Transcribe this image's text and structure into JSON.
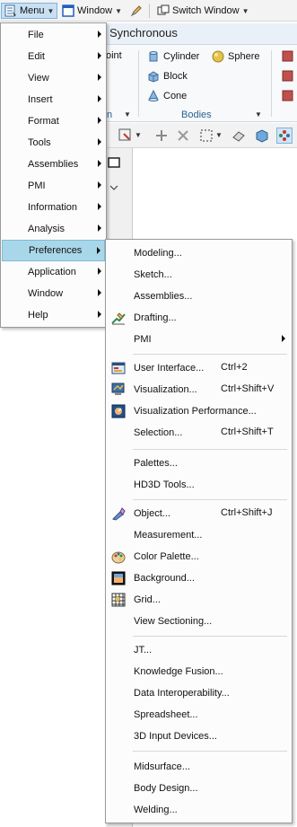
{
  "topbar": {
    "menu_label": "Menu",
    "window_label": "Window",
    "switch_window_label": "Switch Window"
  },
  "ribbon": {
    "tab_label": "Synchronous",
    "point_label": "oint",
    "group_label_left": "n",
    "cylinder_label": "Cylinder",
    "sphere_label": "Sphere",
    "block_label": "Block",
    "cone_label": "Cone",
    "bodies_group_label": "Bodies"
  },
  "main_menu": {
    "items": [
      {
        "label": "File"
      },
      {
        "label": "Edit"
      },
      {
        "label": "View"
      },
      {
        "label": "Insert"
      },
      {
        "label": "Format"
      },
      {
        "label": "Tools"
      },
      {
        "label": "Assemblies"
      },
      {
        "label": "PMI"
      },
      {
        "label": "Information"
      },
      {
        "label": "Analysis"
      },
      {
        "label": "Preferences"
      },
      {
        "label": "Application"
      },
      {
        "label": "Window"
      },
      {
        "label": "Help"
      }
    ],
    "highlighted": "Preferences"
  },
  "preferences_menu": {
    "items": [
      {
        "label": "Modeling...",
        "shortcut": "",
        "icon": ""
      },
      {
        "label": "Sketch...",
        "shortcut": "",
        "icon": ""
      },
      {
        "label": "Assemblies...",
        "shortcut": "",
        "icon": ""
      },
      {
        "label": "Drafting...",
        "shortcut": "",
        "icon": "drafting-icon"
      },
      {
        "label": "PMI",
        "shortcut": "",
        "icon": "",
        "submenu": true
      },
      {
        "label": "User Interface...",
        "shortcut": "Ctrl+2",
        "icon": "user-interface-icon"
      },
      {
        "label": "Visualization...",
        "shortcut": "Ctrl+Shift+V",
        "icon": "visualization-icon"
      },
      {
        "label": "Visualization Performance...",
        "shortcut": "",
        "icon": "visualization-performance-icon"
      },
      {
        "label": "Selection...",
        "shortcut": "Ctrl+Shift+T",
        "icon": ""
      },
      {
        "label": "Palettes...",
        "shortcut": "",
        "icon": ""
      },
      {
        "label": "HD3D Tools...",
        "shortcut": "",
        "icon": ""
      },
      {
        "label": "Object...",
        "shortcut": "Ctrl+Shift+J",
        "icon": "object-icon"
      },
      {
        "label": "Measurement...",
        "shortcut": "",
        "icon": ""
      },
      {
        "label": "Color Palette...",
        "shortcut": "",
        "icon": "color-palette-icon"
      },
      {
        "label": "Background...",
        "shortcut": "",
        "icon": "background-icon"
      },
      {
        "label": "Grid...",
        "shortcut": "",
        "icon": "grid-icon"
      },
      {
        "label": "View Sectioning...",
        "shortcut": "",
        "icon": ""
      },
      {
        "label": "JT...",
        "shortcut": "",
        "icon": ""
      },
      {
        "label": "Knowledge Fusion...",
        "shortcut": "",
        "icon": ""
      },
      {
        "label": "Data Interoperability...",
        "shortcut": "",
        "icon": ""
      },
      {
        "label": "Spreadsheet...",
        "shortcut": "",
        "icon": ""
      },
      {
        "label": "3D Input Devices...",
        "shortcut": "",
        "icon": ""
      },
      {
        "label": "Midsurface...",
        "shortcut": "",
        "icon": ""
      },
      {
        "label": "Body Design...",
        "shortcut": "",
        "icon": ""
      },
      {
        "label": "Welding...",
        "shortcut": "",
        "icon": ""
      }
    ]
  }
}
